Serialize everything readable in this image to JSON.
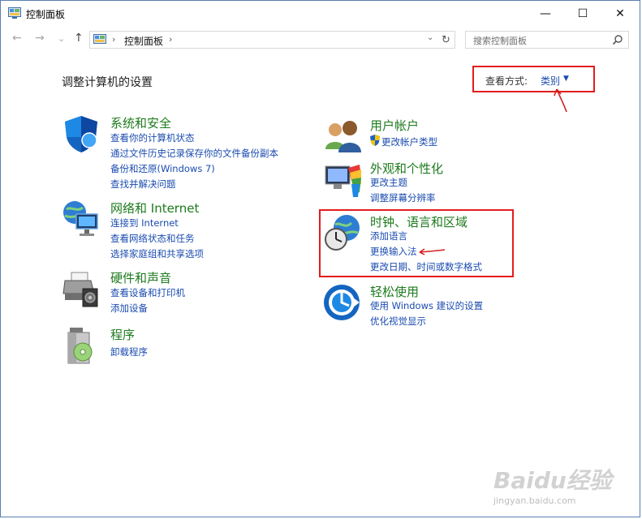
{
  "window": {
    "title": "控制面板",
    "minimize_glyph": "—",
    "maximize_glyph": "☐",
    "close_glyph": "✕"
  },
  "address": {
    "back_glyph": "←",
    "forward_glyph": "→",
    "recent_glyph": "⌄",
    "up_glyph": "↑",
    "separator_glyph": "›",
    "crumb": "控制面板",
    "dropdown_glyph": "⌄",
    "refresh_glyph": "↻",
    "search_placeholder": "搜索控制面板"
  },
  "main": {
    "heading": "调整计算机的设置",
    "view_by_label": "查看方式:",
    "view_by_value": "类别",
    "view_by_caret": "▼"
  },
  "categories_left": [
    {
      "title": "系统和安全",
      "links": [
        "查看你的计算机状态",
        "通过文件历史记录保存你的文件备份副本",
        "备份和还原(Windows 7)",
        "查找并解决问题"
      ]
    },
    {
      "title": "网络和 Internet",
      "links": [
        "连接到 Internet",
        "查看网络状态和任务",
        "选择家庭组和共享选项"
      ]
    },
    {
      "title": "硬件和声音",
      "links": [
        "查看设备和打印机",
        "添加设备"
      ]
    },
    {
      "title": "程序",
      "links": [
        "卸载程序"
      ]
    }
  ],
  "categories_right": [
    {
      "title": "用户帐户",
      "links": [
        "更改帐户类型"
      ]
    },
    {
      "title": "外观和个性化",
      "links": [
        "更改主题",
        "调整屏幕分辨率"
      ]
    },
    {
      "title": "时钟、语言和区域",
      "links": [
        "添加语言",
        "更换输入法",
        "更改日期、时间或数字格式"
      ]
    },
    {
      "title": "轻松使用",
      "links": [
        "使用 Windows 建议的设置",
        "优化视觉显示"
      ]
    }
  ],
  "watermark": {
    "brand": "Baidu经验",
    "url": "jingyan.baidu.com"
  },
  "colors": {
    "accent_link": "#1a4bb0",
    "category_title": "#1d7a1d",
    "annotation_red": "#e41c1c"
  }
}
